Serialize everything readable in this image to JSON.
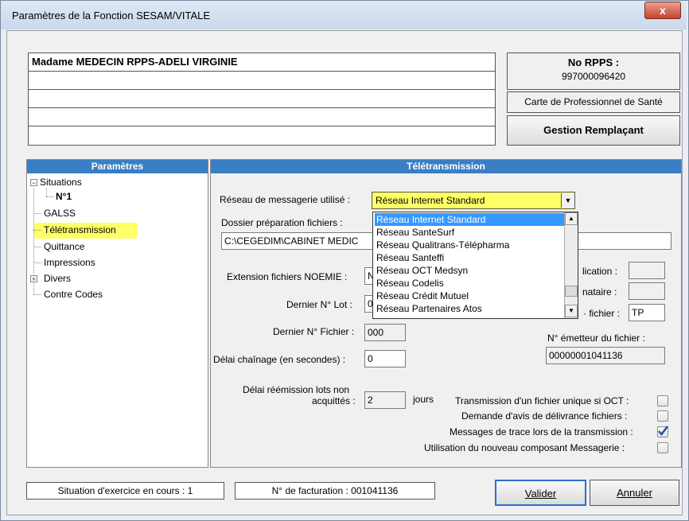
{
  "window": {
    "title": "Paramètres de la Fonction SESAM/VITALE",
    "close_label": "x"
  },
  "user": {
    "name": "Madame MEDECIN RPPS-ADELI VIRGINIE"
  },
  "rpps": {
    "label": "No RPPS :",
    "value": "997000096420",
    "carte": "Carte de Professionnel de Santé",
    "gestion_button": "Gestion Remplaçant"
  },
  "params": {
    "header": "Paramètres",
    "tree": {
      "situations": "Situations",
      "n1": "N°1",
      "galss": "GALSS",
      "teletransmission": "Télétransmission",
      "quittance": "Quittance",
      "impressions": "Impressions",
      "divers": "Divers",
      "contre_codes": "Contre Codes"
    },
    "expander_minus": "−",
    "expander_plus": "+"
  },
  "tele": {
    "header": "Télétransmission",
    "reseau_label": "Réseau de messagerie utilisé :",
    "reseau_value": "Réseau Internet Standard",
    "dossier_label": "Dossier préparation fichiers :",
    "dossier_value": "C:\\CEGEDIM\\CABINET MEDIC",
    "extension_label": "Extension fichiers NOEMIE :",
    "extension_value": "N",
    "dernier_lot_label": "Dernier N° Lot :",
    "dernier_lot_value": "0",
    "application_label": "lication :",
    "destinataire_label": "nataire :",
    "type_fichier_label": "· fichier :",
    "type_fichier_value": "TP",
    "dernier_fichier_label": "Dernier N° Fichier :",
    "dernier_fichier_value": "000",
    "delai_chainage_label": "Délai chaînage (en secondes) :",
    "delai_chainage_value": "0",
    "emetteur_label": "N° émetteur du fichier :",
    "emetteur_value": "00000001041136",
    "delai_reemission_label_1": "Délai réémission lots non",
    "delai_reemission_label_2": "acquittés :",
    "delai_reemission_value": "2",
    "jours": "jours",
    "options": [
      {
        "label": "Transmission d'un fichier unique si OCT :",
        "checked": false
      },
      {
        "label": "Demande d'avis de délivrance fichiers :",
        "checked": false
      },
      {
        "label": "Messages de trace lors de la transmission :",
        "checked": true
      },
      {
        "label": "Utilisation du nouveau composant Messagerie :",
        "checked": false
      }
    ],
    "dropdown_options": [
      "Réseau Internet Standard",
      "Réseau SanteSurf",
      "Réseau Qualitrans-Télépharma",
      "Réseau Santeffi",
      "Réseau OCT Medsyn",
      "Réseau Codelis",
      "Réseau Crédit Mutuel",
      "Réseau Partenaires Atos"
    ],
    "dropdown_selected_index": 0
  },
  "footer": {
    "situation": "Situation d'exercice en cours : 1",
    "facturation": "N° de facturation : 001041136",
    "valider": "Valider",
    "annuler": "Annuler"
  },
  "colors": {
    "header_blue": "#3a7fc4",
    "highlight_yellow": "#ffff66",
    "selection_blue": "#3399ff"
  }
}
